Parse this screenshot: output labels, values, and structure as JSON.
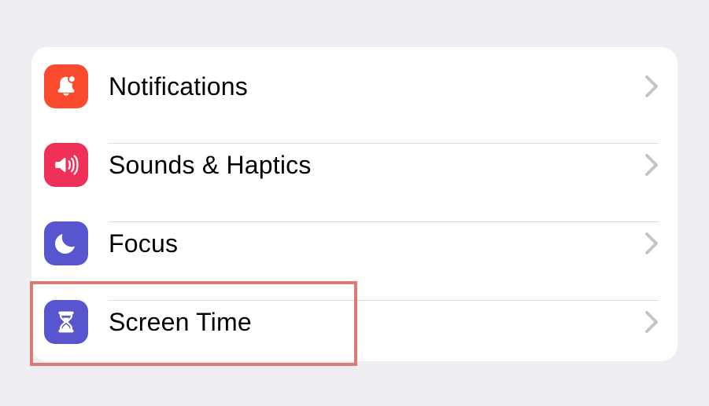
{
  "settings": {
    "items": [
      {
        "id": "notifications",
        "label": "Notifications",
        "icon": "bell-badge-icon",
        "bg": "#fb4b2e"
      },
      {
        "id": "sounds",
        "label": "Sounds & Haptics",
        "icon": "speaker-icon",
        "bg": "#ef3159"
      },
      {
        "id": "focus",
        "label": "Focus",
        "icon": "moon-icon",
        "bg": "#5856ce"
      },
      {
        "id": "screentime",
        "label": "Screen Time",
        "icon": "hourglass-icon",
        "bg": "#5856ce"
      }
    ]
  },
  "annotation": {
    "highlighted_item_id": "screentime"
  }
}
